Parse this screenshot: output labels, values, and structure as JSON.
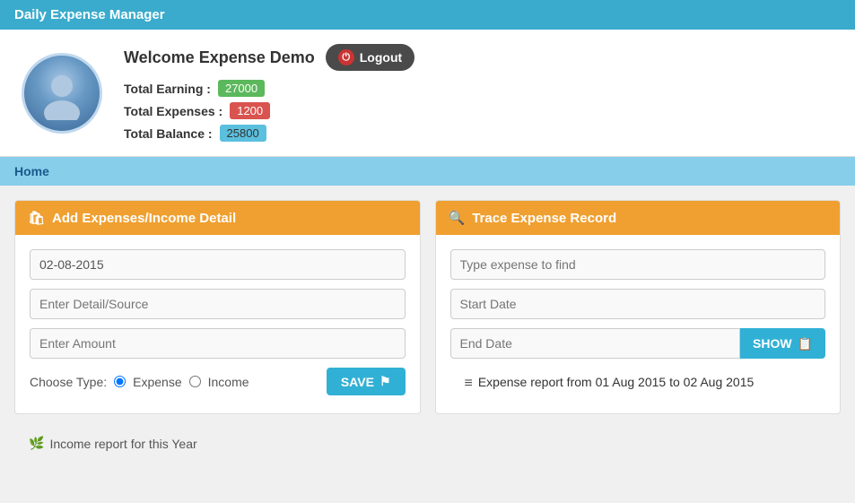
{
  "header": {
    "title": "Daily Expense Manager"
  },
  "profile": {
    "welcome_text": "Welcome Expense Demo",
    "logout_label": "Logout",
    "total_earning_label": "Total Earning :",
    "total_earning_value": "27000",
    "total_expenses_label": "Total Expenses :",
    "total_expenses_value": "1200",
    "total_balance_label": "Total Balance :",
    "total_balance_value": "25800"
  },
  "nav": {
    "home_label": "Home"
  },
  "add_panel": {
    "header": "Add Expenses/Income Detail",
    "date_value": "02-08-2015",
    "detail_placeholder": "Enter Detail/Source",
    "amount_placeholder": "Enter Amount",
    "choose_type_label": "Choose Type:",
    "expense_label": "Expense",
    "income_label": "Income",
    "save_label": "SAVE"
  },
  "trace_panel": {
    "header": "Trace Expense Record",
    "search_placeholder": "Type expense to find",
    "start_date_placeholder": "Start Date",
    "end_date_placeholder": "End Date",
    "show_label": "SHOW",
    "report_text": "Expense report from 01 Aug 2015 to 02 Aug 2015"
  },
  "bottom": {
    "income_report_text": "Income report for this Year"
  }
}
